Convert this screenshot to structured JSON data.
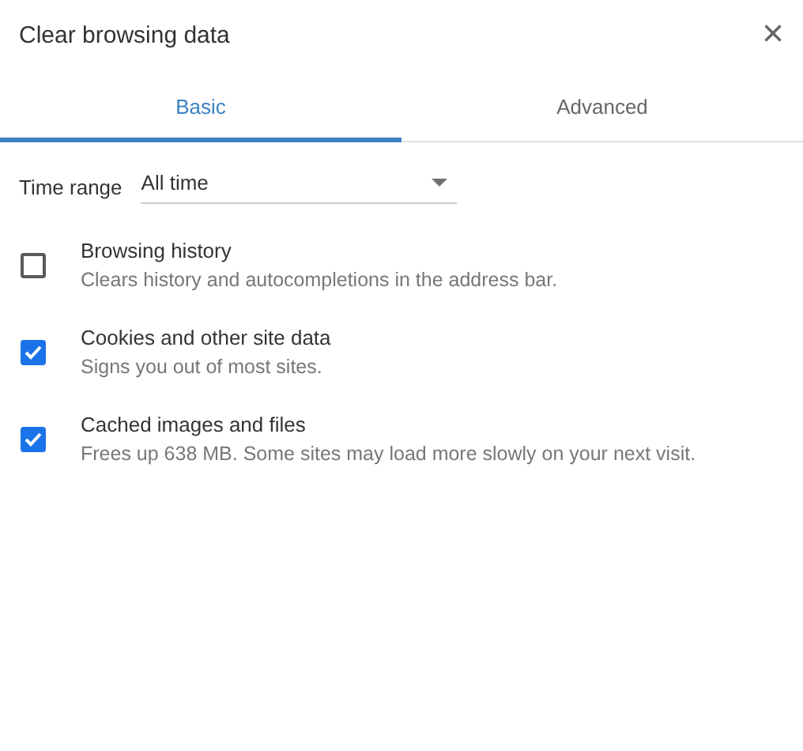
{
  "dialog": {
    "title": "Clear browsing data",
    "close": "×"
  },
  "tabs": [
    {
      "label": "Basic",
      "selected": true
    },
    {
      "label": "Advanced",
      "selected": false
    }
  ],
  "time_range": {
    "label": "Time range",
    "value": "All time"
  },
  "options": [
    {
      "title": "Browsing history",
      "description": "Clears history and autocompletions in the address bar.",
      "checked": false
    },
    {
      "title": "Cookies and other site data",
      "description": "Signs you out of most sites.",
      "checked": true
    },
    {
      "title": "Cached images and files",
      "description": "Frees up 638 MB. Some sites may load more slowly on your next visit.",
      "checked": true
    }
  ]
}
